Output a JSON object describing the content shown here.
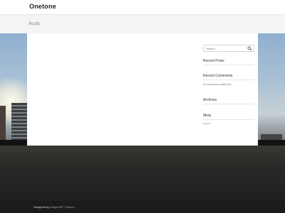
{
  "site": {
    "name": "Onetone"
  },
  "breadcrumb": {
    "label": "BLOG"
  },
  "sidebar": {
    "search": {
      "placeholder": "Search ..."
    },
    "recent_posts": {
      "title": "Recent Posts"
    },
    "recent_comments": {
      "title": "Recent Comments",
      "empty_text": "No comments added yet."
    },
    "archives": {
      "title": "Archives"
    },
    "meta": {
      "title": "Meta",
      "login_label": "Log in"
    }
  },
  "footer": {
    "designed_prefix": "Designed by",
    "designed_by": "MageeWP Themes."
  },
  "icons": {
    "search": "search-icon"
  }
}
